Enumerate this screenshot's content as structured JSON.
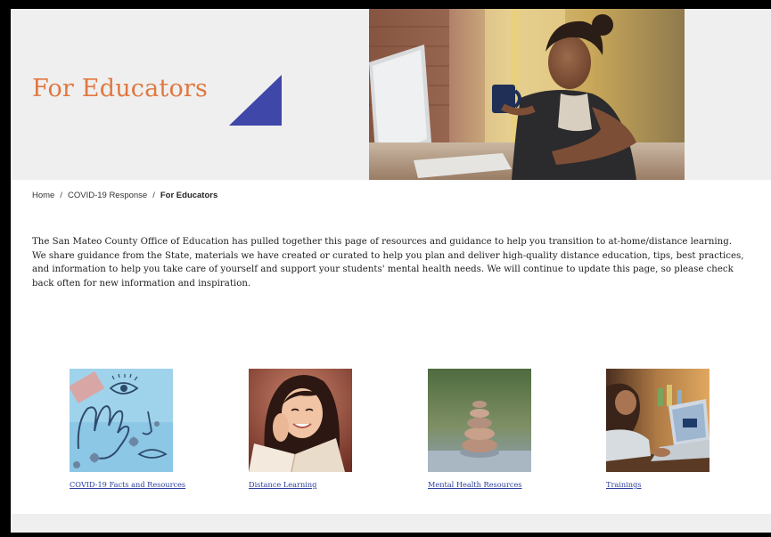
{
  "hero": {
    "title": "For Educators"
  },
  "breadcrumb": {
    "items": [
      "Home",
      "COVID-19 Response"
    ],
    "separator": "/",
    "current": "For Educators"
  },
  "intro": {
    "text": "The San Mateo County Office of Education has pulled together this page of resources and guidance to help you transition to at-home/distance learning. We share guidance from the State, materials we have created or curated to help you plan and deliver high-quality distance education, tips, best practices, and information to help you take care of yourself and support your students' mental health needs. We will continue to update this page, so please check back often for new information and inspiration."
  },
  "cards": [
    {
      "label": "COVID-19 Facts and Resources",
      "image": "covid-illustration"
    },
    {
      "label": "Distance Learning",
      "image": "girl-reading-book"
    },
    {
      "label": "Mental Health Resources",
      "image": "stacked-stones"
    },
    {
      "label": "Trainings",
      "image": "laptop-training"
    }
  ],
  "colors": {
    "title": "#e0783f",
    "triangle": "#3f47a8",
    "link": "#2b3f9e",
    "hero_bg": "#efeff0"
  }
}
